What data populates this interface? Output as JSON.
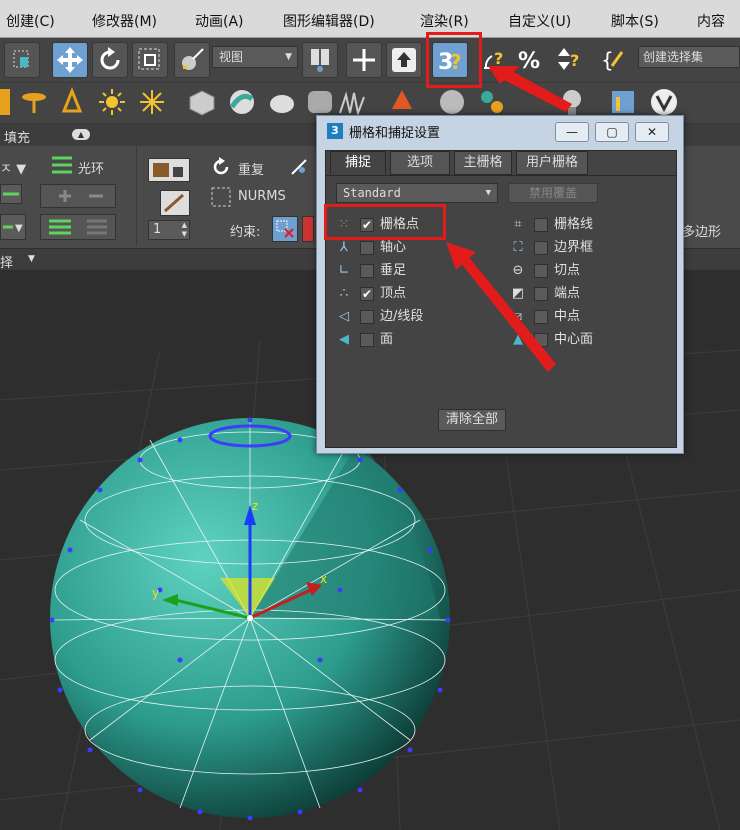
{
  "menubar": {
    "items": [
      "创建(C)",
      "修改器(M)",
      "动画(A)",
      "图形编辑器(D)",
      "渲染(R)",
      "自定义(U)",
      "脚本(S)",
      "内容"
    ]
  },
  "toolbar": {
    "view_dropdown": "视图",
    "create_selection_set": "创建选择集"
  },
  "ribbon": {
    "fill_label": "填充",
    "loop_label": "光环",
    "repeat_label": "重复",
    "nurms_label": "NURMS",
    "constraint_label": "约束:",
    "spinner_value": "1",
    "polygon_label": "多边形",
    "select_label": "择"
  },
  "dialog": {
    "title": "栅格和捕捉设置",
    "min_btn": "—",
    "max_btn": "▢",
    "close_btn": "✕",
    "tabs": [
      "捕捉",
      "选项",
      "主栅格",
      "用户栅格"
    ],
    "active_tab": "捕捉",
    "preset_value": "Standard",
    "override_button": "禁用覆盖",
    "left_options": [
      {
        "label": "栅格点",
        "checked": true,
        "icon": "grid-points-icon"
      },
      {
        "label": "轴心",
        "checked": false,
        "icon": "pivot-icon"
      },
      {
        "label": "垂足",
        "checked": false,
        "icon": "perpendicular-icon"
      },
      {
        "label": "顶点",
        "checked": true,
        "icon": "vertex-icon"
      },
      {
        "label": "边/线段",
        "checked": false,
        "icon": "edge-icon"
      },
      {
        "label": "面",
        "checked": false,
        "icon": "face-icon"
      }
    ],
    "right_options": [
      {
        "label": "栅格线",
        "checked": false,
        "icon": "grid-lines-icon"
      },
      {
        "label": "边界框",
        "checked": false,
        "icon": "bounding-box-icon"
      },
      {
        "label": "切点",
        "checked": false,
        "icon": "tangent-icon"
      },
      {
        "label": "端点",
        "checked": false,
        "icon": "endpoint-icon"
      },
      {
        "label": "中点",
        "checked": false,
        "icon": "midpoint-icon"
      },
      {
        "label": "中心面",
        "checked": false,
        "icon": "center-face-icon"
      }
    ],
    "clear_all_button": "清除全部"
  },
  "viewport": {
    "axis_x": "x",
    "axis_y": "y",
    "axis_z": "z"
  },
  "colors": {
    "annotation_red": "#e21b1b",
    "sphere_teal": "#3aa89a",
    "vertex_blue": "#3c3cff",
    "snap_button_blue": "#6fa0d2"
  }
}
